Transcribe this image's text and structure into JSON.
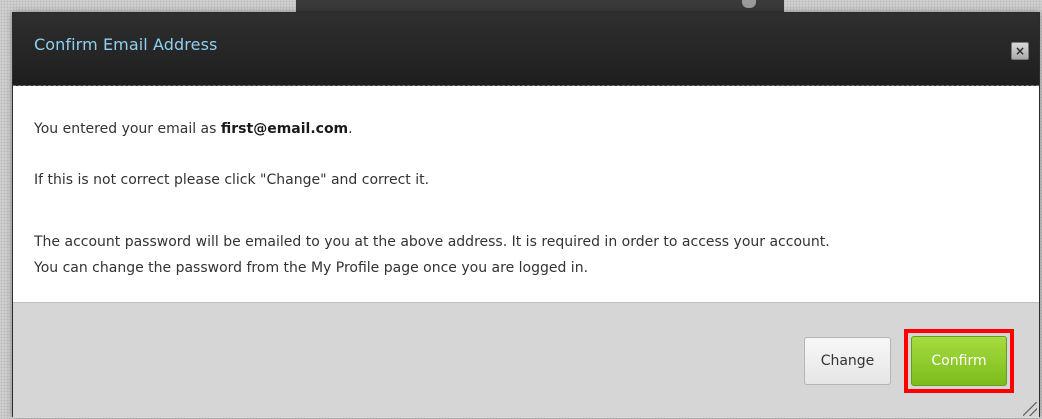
{
  "dialog": {
    "title": "Confirm Email Address",
    "close_label": "×",
    "body": {
      "line1_prefix": "You entered your email as ",
      "email": "first@email.com",
      "line1_suffix": ".",
      "line2": "If this is not correct please click \"Change\" and correct it.",
      "line3": "The account password will be emailed to you at the above address. It is required in order to access your account.",
      "line4": "You can change the password from the My Profile page once you are logged in."
    },
    "buttons": {
      "change_label": "Change",
      "confirm_label": "Confirm"
    }
  },
  "colors": {
    "title_text": "#8fd0f0",
    "titlebar_bg": "#262626",
    "footer_bg": "#d6d6d6",
    "confirm_bg": "#8fc92b",
    "highlight": "#ff0000"
  },
  "icons": {
    "close": "close-icon",
    "resize": "resize-grip-icon"
  }
}
